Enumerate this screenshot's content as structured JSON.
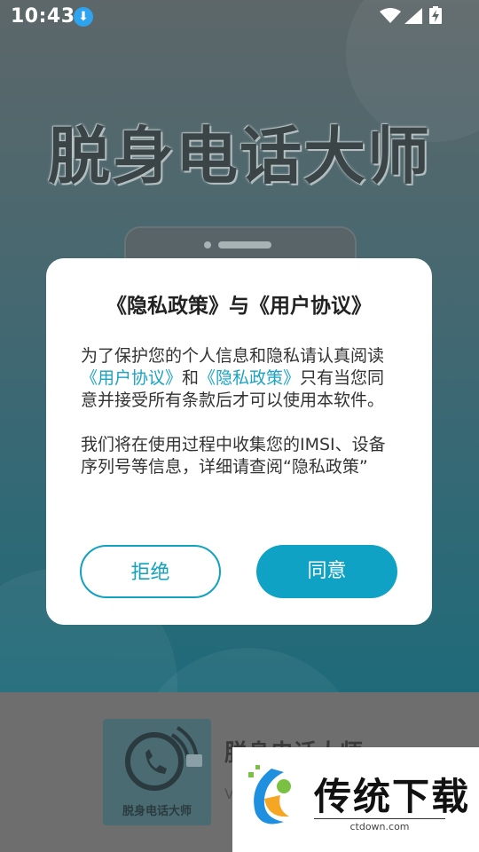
{
  "status_bar": {
    "time": "10:43"
  },
  "background": {
    "app_title": "脱身电话大师"
  },
  "dialog": {
    "title": "《隐私政策》与《用户协议》",
    "para1_a": "为了保护您的个人信息和隐私请认真阅读",
    "link_user_agreement": "《用户协议》",
    "para1_and": "和",
    "link_privacy_policy": "《隐私政策》",
    "para1_b": "只有当您同意并接受所有条款后才可以使用本软件。",
    "para2": "我们将在使用过程中收集您的IMSI、设备序列号等信息，详细请查阅“隐私政策”",
    "reject_label": "拒绝",
    "agree_label": "同意"
  },
  "app_card": {
    "icon_label": "脱身电话大师",
    "name": "脱身电话大师",
    "version": "V"
  },
  "watermark": {
    "text": "传统下载",
    "url": "ctdown.com"
  },
  "colors": {
    "accent": "#0fa2c4",
    "dim_bg": "#5d6769"
  }
}
